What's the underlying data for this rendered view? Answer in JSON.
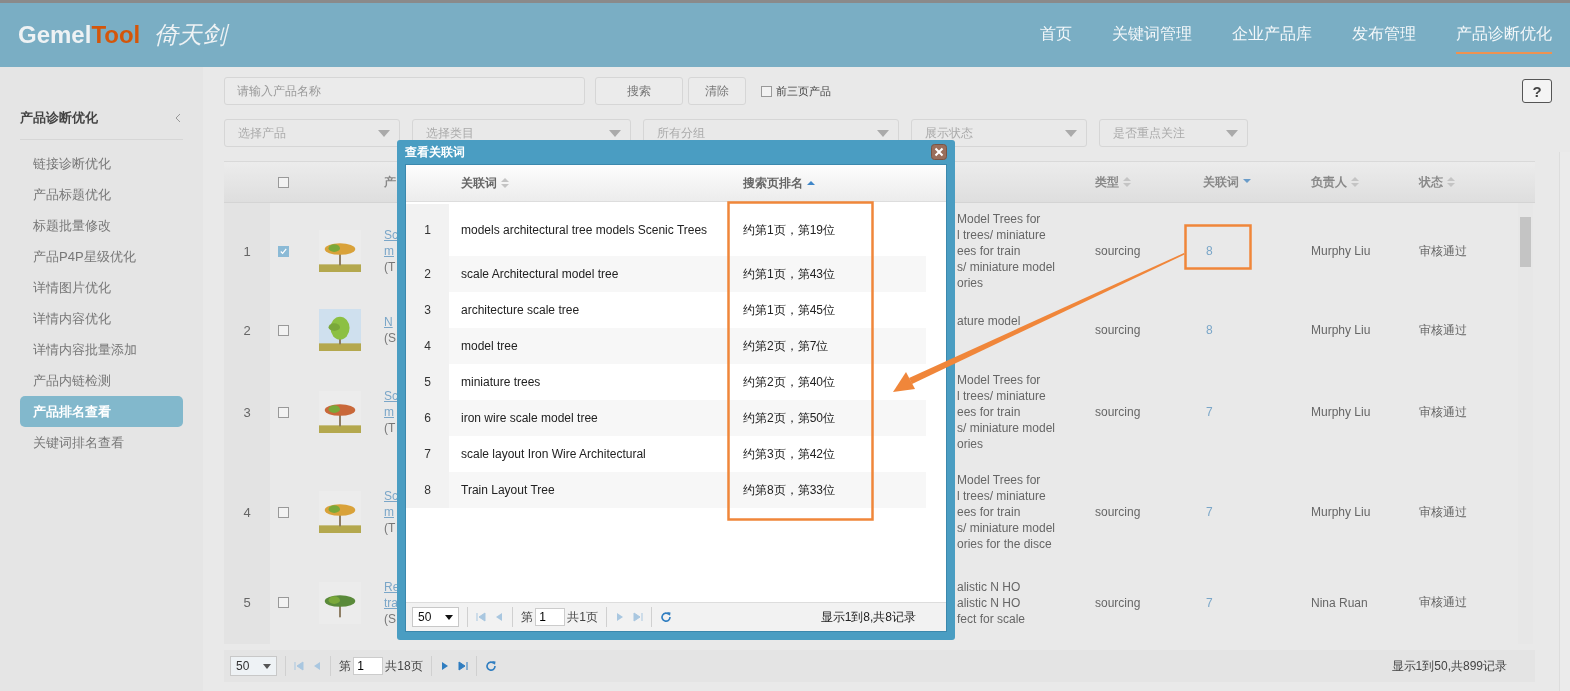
{
  "header": {
    "logo": {
      "part_a": "Gemel",
      "part_b": "Tool",
      "part_c": "倚天剑"
    },
    "nav": [
      {
        "label": "首页",
        "selected": false
      },
      {
        "label": "关键词管理",
        "selected": false
      },
      {
        "label": "企业产品库",
        "selected": false
      },
      {
        "label": "发布管理",
        "selected": false
      },
      {
        "label": "产品诊断优化",
        "selected": true
      }
    ]
  },
  "sidebar": {
    "title": "产品诊断优化",
    "items": [
      {
        "label": "链接诊断优化",
        "selected": false
      },
      {
        "label": "产品标题优化",
        "selected": false
      },
      {
        "label": "标题批量修改",
        "selected": false
      },
      {
        "label": "产品P4P星级优化",
        "selected": false
      },
      {
        "label": "详情图片优化",
        "selected": false
      },
      {
        "label": "详情内容优化",
        "selected": false
      },
      {
        "label": "详情内容批量添加",
        "selected": false
      },
      {
        "label": "产品内链检测",
        "selected": false
      },
      {
        "label": "产品排名查看",
        "selected": true
      },
      {
        "label": "关键词排名查看",
        "selected": false
      }
    ]
  },
  "filters": {
    "search": {
      "placeholder": "请输入产品名称"
    },
    "search_button": "搜索",
    "clear_button": "清除",
    "top_pages": {
      "label": "前三页产品",
      "checked": false
    },
    "dropdowns": [
      {
        "placeholder": "选择产品"
      },
      {
        "placeholder": "选择类目"
      },
      {
        "placeholder": "所有分组"
      },
      {
        "placeholder": "展示状态"
      },
      {
        "placeholder": "是否重点关注"
      }
    ]
  },
  "help": "?",
  "table": {
    "select_all": false,
    "columns": [
      {
        "label": "产"
      },
      {
        "label": "类型",
        "sorted": false
      },
      {
        "label": "关联词",
        "sorted": true,
        "ascending": false
      },
      {
        "label": "负责人",
        "sorted": false
      },
      {
        "label": "状态",
        "sorted": false
      }
    ],
    "rows": [
      {
        "index": "1",
        "checked": true,
        "title_links": [
          "Sc",
          "m"
        ],
        "title_note": "(T",
        "detail": [
          "Model Trees for",
          "l trees/ miniature",
          "ees for train",
          "s/ miniature model",
          "ories"
        ],
        "type": "sourcing",
        "keywords": "8",
        "owner": "Murphy Liu",
        "status": "审核通过"
      },
      {
        "index": "2",
        "checked": false,
        "title_links": [
          "N"
        ],
        "title_note": "(S",
        "detail": [
          "ature model"
        ],
        "type": "sourcing",
        "keywords": "8",
        "owner": "Murphy Liu",
        "status": "审核通过"
      },
      {
        "index": "3",
        "checked": false,
        "title_links": [
          "Sc",
          "m"
        ],
        "title_note": "(T",
        "detail": [
          "Model Trees for",
          "l trees/ miniature",
          "ees for train",
          "s/ miniature model",
          "ories"
        ],
        "type": "sourcing",
        "keywords": "7",
        "owner": "Murphy Liu",
        "status": "审核通过"
      },
      {
        "index": "4",
        "checked": false,
        "title_links": [
          "Sc",
          "m"
        ],
        "title_note": "(T",
        "detail": [
          "Model Trees for",
          "l trees/ miniature",
          "ees for train",
          "s/ miniature model",
          "ories for the disce"
        ],
        "type": "sourcing",
        "keywords": "7",
        "owner": "Murphy Liu",
        "status": "审核通过"
      },
      {
        "index": "5",
        "checked": false,
        "title_links": [
          "Re",
          "tra"
        ],
        "title_note": "(S",
        "detail": [
          "alistic N HO",
          "alistic N HO",
          "fect for scale"
        ],
        "type": "sourcing",
        "keywords": "7",
        "owner": "Nina Ruan",
        "status": "审核通过"
      }
    ]
  },
  "pager": {
    "page_size": "50",
    "page_prefix": "第",
    "page": "1",
    "page_total": "共18页",
    "summary": "显示1到50,共899记录"
  },
  "dialog": {
    "title": "查看关联词",
    "columns": [
      {
        "label": "关联词",
        "sorted": false
      },
      {
        "label": "搜索页排名",
        "sorted": true,
        "ascending": true
      }
    ],
    "rows": [
      {
        "index": "1",
        "keyword": "models architectural tree models Scenic Trees",
        "rank": "约第1页，第19位"
      },
      {
        "index": "2",
        "keyword": "scale Architectural model tree",
        "rank": "约第1页，第43位"
      },
      {
        "index": "3",
        "keyword": "architecture scale tree",
        "rank": "约第1页，第45位"
      },
      {
        "index": "4",
        "keyword": "model tree",
        "rank": "约第2页，第7位"
      },
      {
        "index": "5",
        "keyword": "miniature trees",
        "rank": "约第2页，第40位"
      },
      {
        "index": "6",
        "keyword": "iron wire scale model tree",
        "rank": "约第2页，第50位"
      },
      {
        "index": "7",
        "keyword": "scale layout Iron Wire Architectural",
        "rank": "约第3页，第42位"
      },
      {
        "index": "8",
        "keyword": "Train Layout Tree",
        "rank": "约第8页，第33位"
      }
    ],
    "pager": {
      "page_size": "50",
      "page_prefix": "第",
      "page": "1",
      "page_total": "共1页",
      "summary": "显示1到8,共8记录"
    }
  }
}
